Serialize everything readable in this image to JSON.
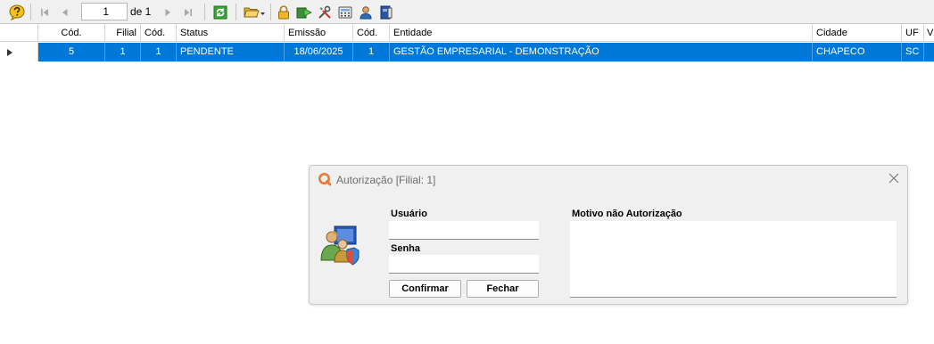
{
  "toolbar": {
    "record_number": "1",
    "record_of": "de 1",
    "icons": [
      "help-icon",
      "first-record-icon",
      "prev-record-icon",
      "next-record-icon",
      "last-record-icon",
      "refresh-icon",
      "open-folder-icon",
      "lock-icon",
      "execute-icon",
      "tools-icon",
      "calculator-icon",
      "user-icon",
      "book-icon"
    ]
  },
  "grid": {
    "headers": [
      "Cód.",
      "Filial",
      "Cód.",
      "Status",
      "Emissão",
      "Cód.",
      "Entidade",
      "Cidade",
      "UF",
      "V"
    ],
    "rows": [
      [
        "5",
        "1",
        "1",
        "PENDENTE",
        "18/06/2025",
        "1",
        "GESTÃO EMPRESARIAL - DEMONSTRAÇÃO",
        "CHAPECO",
        "SC",
        ""
      ]
    ],
    "selected_color": "#0078d7"
  },
  "dialog": {
    "title": "Autorização [Filial: 1]",
    "user_label": "Usuário",
    "user_value": "",
    "password_label": "Senha",
    "password_value": "",
    "reason_label": "Motivo não Autorização",
    "reason_value": "",
    "confirm_label": "Confirmar",
    "close_label": "Fechar",
    "accent": "#e8793a"
  }
}
